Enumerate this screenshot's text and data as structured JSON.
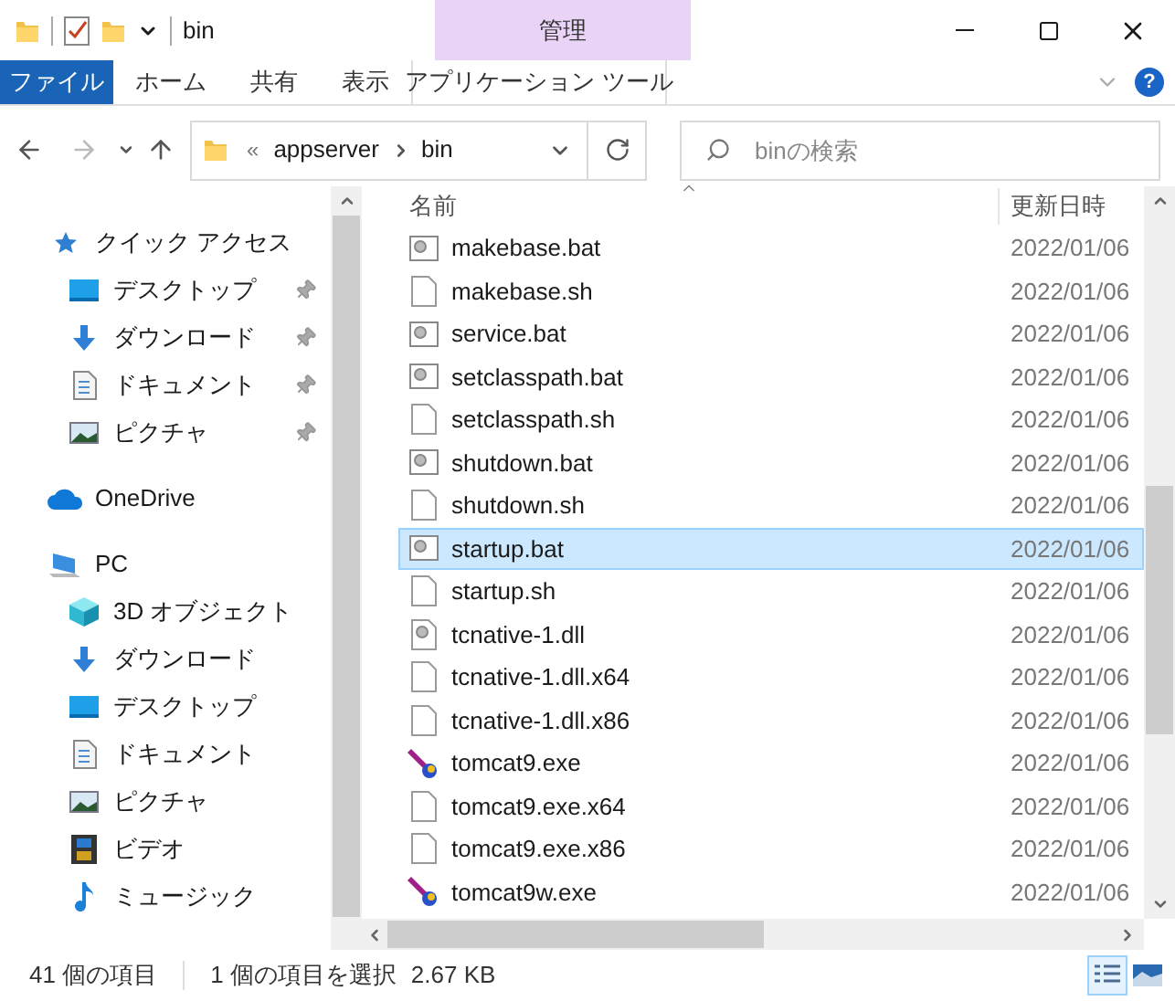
{
  "window": {
    "title": "bin"
  },
  "ribbon": {
    "context_group": "管理",
    "tabs": [
      {
        "label": "ファイル",
        "kind": "file"
      },
      {
        "label": "ホーム",
        "kind": "plain"
      },
      {
        "label": "共有",
        "kind": "plain"
      },
      {
        "label": "表示",
        "kind": "plain"
      },
      {
        "label": "アプリケーション ツール",
        "kind": "context"
      }
    ]
  },
  "address": {
    "overflow": "«",
    "breadcrumbs": [
      "appserver",
      "bin"
    ]
  },
  "search": {
    "placeholder": "binの検索"
  },
  "help": {
    "label": "?"
  },
  "sidebar": {
    "groups": [
      {
        "label": "クイック アクセス",
        "kind": "star",
        "children": [
          {
            "label": "デスクトップ",
            "kind": "desktop",
            "pinned": true
          },
          {
            "label": "ダウンロード",
            "kind": "download",
            "pinned": true
          },
          {
            "label": "ドキュメント",
            "kind": "document",
            "pinned": true
          },
          {
            "label": "ピクチャ",
            "kind": "picture",
            "pinned": true
          }
        ]
      },
      {
        "label": "OneDrive",
        "kind": "cloud"
      },
      {
        "label": "PC",
        "kind": "pc",
        "children": [
          {
            "label": "3D オブジェクト",
            "kind": "cube",
            "pinned": false
          },
          {
            "label": "ダウンロード",
            "kind": "download",
            "pinned": false
          },
          {
            "label": "デスクトップ",
            "kind": "desktop",
            "pinned": false
          },
          {
            "label": "ドキュメント",
            "kind": "document",
            "pinned": false
          },
          {
            "label": "ピクチャ",
            "kind": "picture",
            "pinned": false
          },
          {
            "label": "ビデオ",
            "kind": "video",
            "pinned": false
          },
          {
            "label": "ミュージック",
            "kind": "music",
            "pinned": false
          }
        ]
      }
    ]
  },
  "file_list": {
    "columns": [
      "名前",
      "更新日時"
    ],
    "rows": [
      {
        "name": "makebase.bat",
        "kind": "bat",
        "date": "2022/01/06",
        "selected": false
      },
      {
        "name": "makebase.sh",
        "kind": "sh",
        "date": "2022/01/06",
        "selected": false
      },
      {
        "name": "service.bat",
        "kind": "bat",
        "date": "2022/01/06",
        "selected": false
      },
      {
        "name": "setclasspath.bat",
        "kind": "bat",
        "date": "2022/01/06",
        "selected": false
      },
      {
        "name": "setclasspath.sh",
        "kind": "sh",
        "date": "2022/01/06",
        "selected": false
      },
      {
        "name": "shutdown.bat",
        "kind": "bat",
        "date": "2022/01/06",
        "selected": false
      },
      {
        "name": "shutdown.sh",
        "kind": "sh",
        "date": "2022/01/06",
        "selected": false
      },
      {
        "name": "startup.bat",
        "kind": "bat",
        "date": "2022/01/06",
        "selected": true
      },
      {
        "name": "startup.sh",
        "kind": "sh",
        "date": "2022/01/06",
        "selected": false
      },
      {
        "name": "tcnative-1.dll",
        "kind": "dll",
        "date": "2022/01/06",
        "selected": false
      },
      {
        "name": "tcnative-1.dll.x64",
        "kind": "sh",
        "date": "2022/01/06",
        "selected": false
      },
      {
        "name": "tcnative-1.dll.x86",
        "kind": "sh",
        "date": "2022/01/06",
        "selected": false
      },
      {
        "name": "tomcat9.exe",
        "kind": "exe",
        "date": "2022/01/06",
        "selected": false
      },
      {
        "name": "tomcat9.exe.x64",
        "kind": "sh",
        "date": "2022/01/06",
        "selected": false
      },
      {
        "name": "tomcat9.exe.x86",
        "kind": "sh",
        "date": "2022/01/06",
        "selected": false
      },
      {
        "name": "tomcat9w.exe",
        "kind": "exe",
        "date": "2022/01/06",
        "selected": false
      }
    ]
  },
  "status_bar": {
    "item_count": "41 個の項目",
    "selection": "1 個の項目を選択",
    "size": "2.67 KB",
    "views": [
      {
        "kind": "details",
        "selected": true
      },
      {
        "kind": "tiles",
        "selected": false
      }
    ]
  }
}
